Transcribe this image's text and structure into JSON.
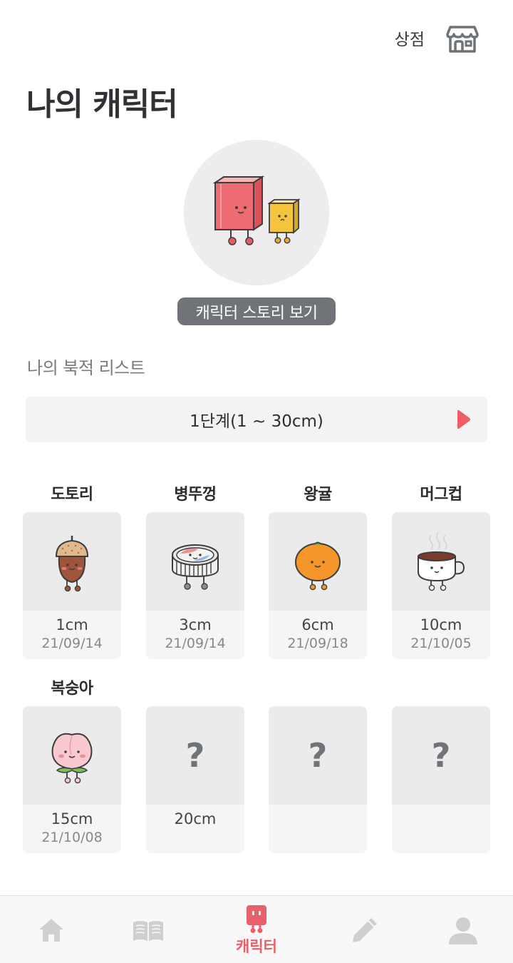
{
  "header": {
    "shop_label": "상점",
    "shop_icon": "store-icon"
  },
  "page_title": "나의 캐릭터",
  "story_button": "캐릭터 스토리 보기",
  "list_section_label": "나의 북적 리스트",
  "stage": {
    "label": "1단계(1 ~ 30cm)",
    "next_icon": "play-arrow-icon",
    "accent": "#ef5d66"
  },
  "characters": [
    {
      "name": "도토리",
      "size": "1cm",
      "date": "21/09/14",
      "icon": "acorn-icon",
      "locked": false
    },
    {
      "name": "병뚜껑",
      "size": "3cm",
      "date": "21/09/14",
      "icon": "bottle-cap-icon",
      "locked": false
    },
    {
      "name": "왕귤",
      "size": "6cm",
      "date": "21/09/18",
      "icon": "tangerine-icon",
      "locked": false
    },
    {
      "name": "머그컵",
      "size": "10cm",
      "date": "21/10/05",
      "icon": "mug-icon",
      "locked": false
    },
    {
      "name": "복숭아",
      "size": "15cm",
      "date": "21/10/08",
      "icon": "peach-icon",
      "locked": false
    },
    {
      "name": "",
      "size": "20cm",
      "date": "",
      "icon": "question-mark",
      "locked": true,
      "placeholder": "?"
    },
    {
      "name": "",
      "size": "",
      "date": "",
      "icon": "question-mark",
      "locked": true,
      "placeholder": "?"
    },
    {
      "name": "",
      "size": "",
      "date": "",
      "icon": "question-mark",
      "locked": true,
      "placeholder": "?"
    }
  ],
  "tabbar": {
    "tabs": [
      {
        "icon": "home-icon",
        "label": "",
        "active": false
      },
      {
        "icon": "book-icon",
        "label": "",
        "active": false
      },
      {
        "icon": "character-icon",
        "label": "캐릭터",
        "active": true
      },
      {
        "icon": "pencil-icon",
        "label": "",
        "active": false
      },
      {
        "icon": "profile-icon",
        "label": "",
        "active": false
      }
    ],
    "active_color": "#e8606a",
    "inactive_color": "#cfcfcf"
  }
}
